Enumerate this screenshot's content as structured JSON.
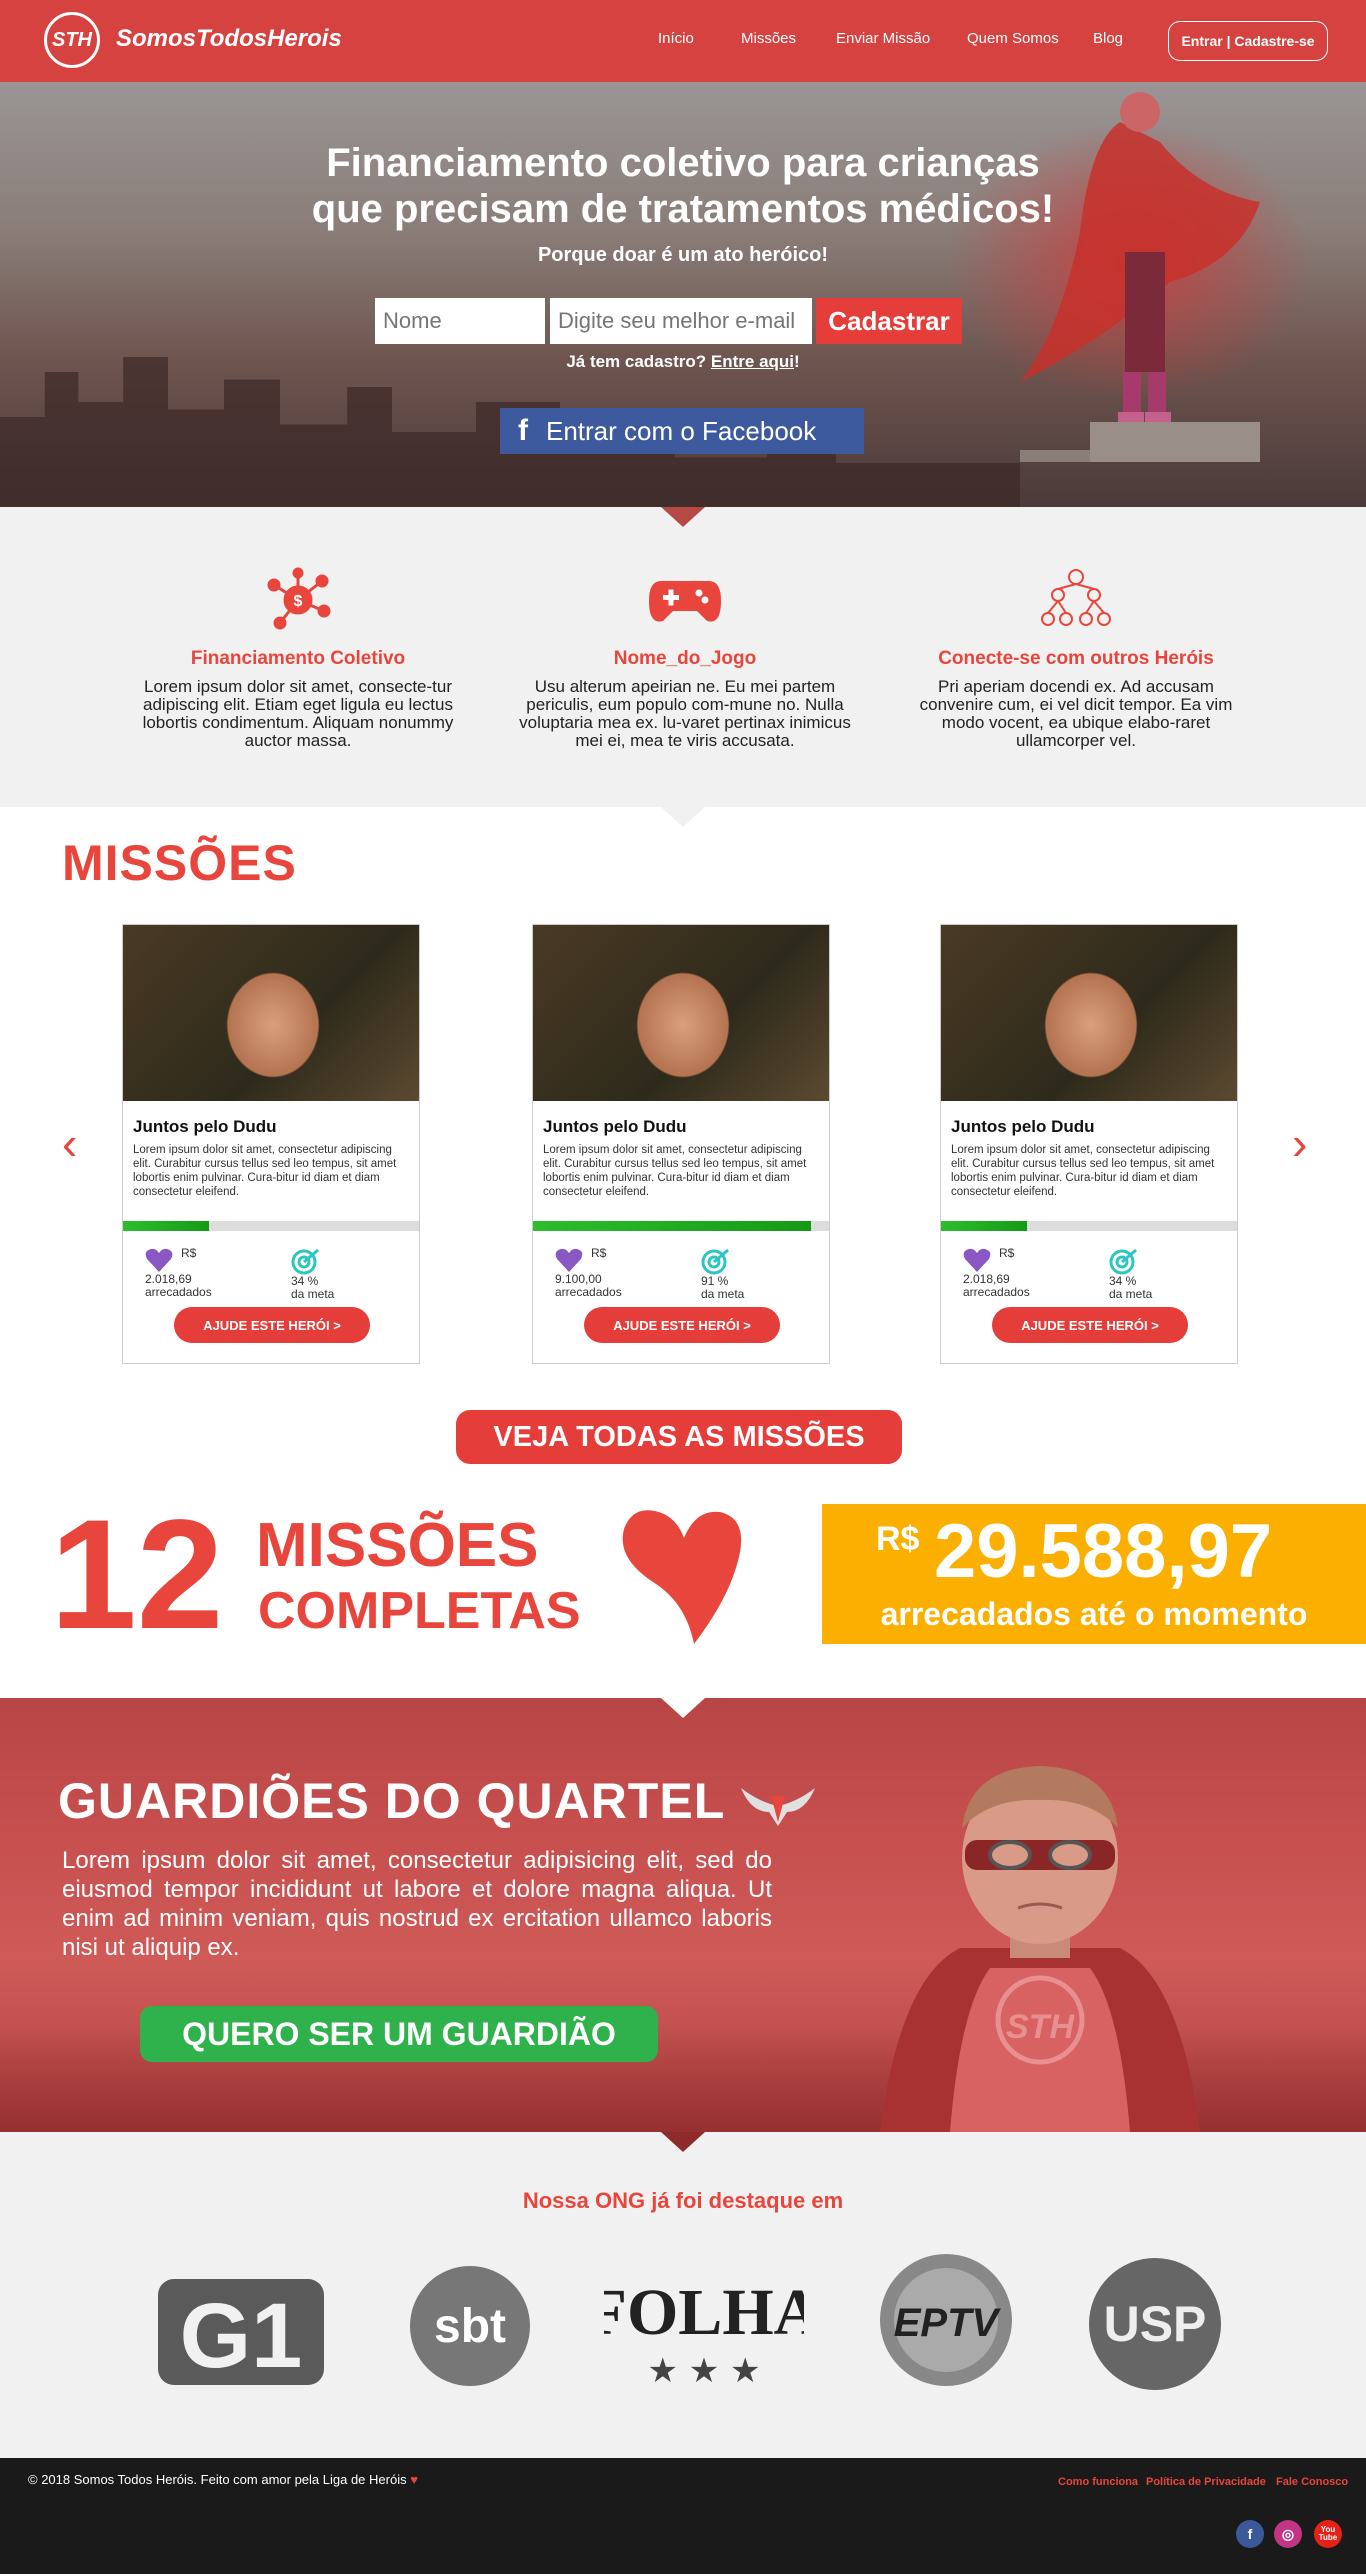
{
  "nav": {
    "logo_mark": "STH",
    "logo_text": "SomosTodosHerois",
    "links": [
      "Início",
      "Missões",
      "Enviar Missão",
      "Quem Somos",
      "Blog"
    ],
    "login": "Entrar | Cadastre-se"
  },
  "hero": {
    "title_line1": "Financiamento coletivo para crianças",
    "title_line2": "que precisam de tratamentos médicos!",
    "subtitle": "Porque doar é um ato heróico!",
    "name_placeholder": "Nome",
    "email_placeholder": "Digite seu melhor e-mail",
    "signup_button": "Cadastrar",
    "already_text": "Já tem cadastro?",
    "already_link": "Entre aqui",
    "already_tail": "!",
    "facebook_icon": "f",
    "facebook_button": "Entrar com o Facebook"
  },
  "features": [
    {
      "icon": "money-network-icon",
      "title": "Financiamento Coletivo",
      "text": "Lorem ipsum dolor sit amet, consecte-tur adipiscing elit. Etiam eget ligula eu lectus lobortis condimentum. Aliquam nonummy auctor massa."
    },
    {
      "icon": "gamepad-icon",
      "title": "Nome_do_Jogo",
      "text": "Usu alterum apeirian ne. Eu mei partem periculis, eum populo com-mune no. Nulla voluptaria mea ex. lu-varet pertinax inimicus mei ei, mea te viris accusata."
    },
    {
      "icon": "people-network-icon",
      "title": "Conecte-se com outros Heróis",
      "text": "Pri aperiam docendi ex. Ad accusam convenire cum, ei vel dicit tempor. Ea vim modo vocent, ea ubique elabo-raret ullamcorper vel."
    }
  ],
  "missions": {
    "title": "MISSÕES",
    "prev_arrow": "‹",
    "next_arrow": "›",
    "cards": [
      {
        "title": "Juntos pelo Dudu",
        "text": "Lorem ipsum dolor sit amet, consectetur adipiscing elit. Curabitur cursus tellus sed leo tempus, sit amet lobortis enim pulvinar. Cura-bitur id diam et diam consectetur eleifend.",
        "raised": "R$ 2.018,69",
        "raised_label": "arrecadados",
        "percent_text": "34 %",
        "goal_label": "da meta",
        "progress": 0.29,
        "button": "AJUDE ESTE HERÓI   >"
      },
      {
        "title": "Juntos pelo Dudu",
        "text": "Lorem ipsum dolor sit amet, consectetur adipiscing elit. Curabitur cursus tellus sed leo tempus, sit amet lobortis enim pulvinar. Cura-bitur id diam et diam consectetur eleifend.",
        "raised": "R$ 9.100,00",
        "raised_label": "arrecadados",
        "percent_text": "91 %",
        "goal_label": "da meta",
        "progress": 0.94,
        "button": "AJUDE ESTE HERÓI   >"
      },
      {
        "title": "Juntos pelo Dudu",
        "text": "Lorem ipsum dolor sit amet, consectetur adipiscing elit. Curabitur cursus tellus sed leo tempus, sit amet lobortis enim pulvinar. Cura-bitur id diam et diam consectetur eleifend.",
        "raised": "R$ 2.018,69",
        "raised_label": "arrecadados",
        "percent_text": "34 %",
        "goal_label": "da meta",
        "progress": 0.29,
        "button": "AJUDE ESTE HERÓI   >"
      }
    ],
    "see_all": "VEJA TODAS AS MISSÕES"
  },
  "stats": {
    "count": "12",
    "count_line1": "MISSÕES",
    "count_line2": "COMPLETAS",
    "currency": "R$",
    "amount": "29.588,97",
    "amount_label": "arrecadados até o momento"
  },
  "guardians": {
    "title": "GUARDIÕES DO QUARTEL",
    "text": "Lorem ipsum dolor sit amet, consectetur adipisicing elit, sed do eiusmod tempor incididunt ut labore et dolore magna aliqua. Ut enim ad minim veniam, quis nostrud ex ercitation ullamco laboris nisi ut aliquip ex.",
    "button": "QUERO SER UM GUARDIÃO",
    "shirt_logo": "STH"
  },
  "press": {
    "title": "Nossa ONG já foi destaque em",
    "logos": [
      "G1",
      "sbt",
      "FOLHA",
      "EPTV",
      "USP"
    ],
    "folha_stars": "★ ★ ★"
  },
  "footer": {
    "copyright": "© 2018 Somos Todos Heróis. Feito com amor pela Liga de Heróis",
    "heart": "♥",
    "links": [
      "Como funciona",
      "Política de Privacidade",
      "Fale Conosco"
    ],
    "social": [
      "f",
      "◎",
      "You Tube"
    ]
  },
  "colors": {
    "brand_red": "#e8453c",
    "nav_red": "#d5423f",
    "money_yellow": "#fbb001",
    "guardian_green": "#2fb14b",
    "facebook_blue": "#3e5a9e"
  }
}
